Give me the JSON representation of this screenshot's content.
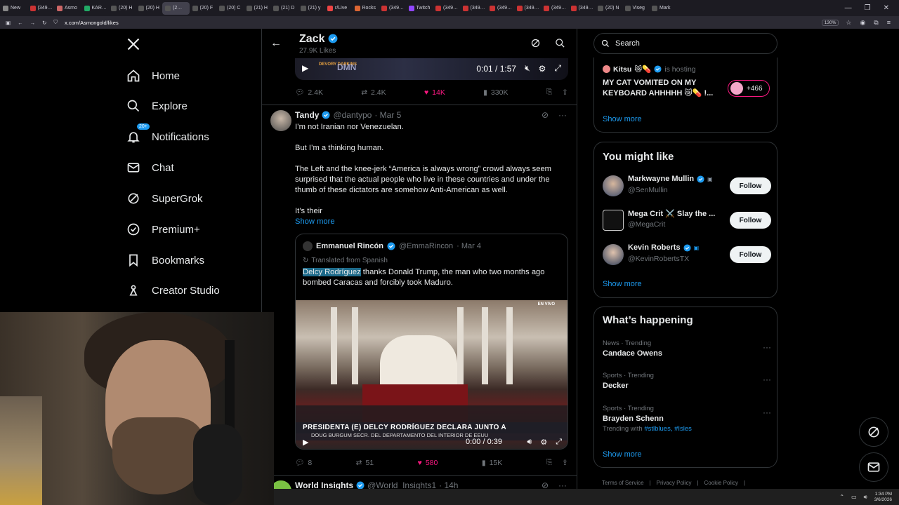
{
  "browser": {
    "tabs": [
      "New",
      "(349…",
      "Asmo",
      "KAR…",
      "(20) H",
      "(20) H",
      "(2…",
      "(20) F",
      "(20) C",
      "(21) H",
      "(21) D",
      "(21) y",
      "r/Live",
      "Rocks",
      "(349…",
      "Twitch",
      "(349…",
      "(349…",
      "(349…",
      "(349…",
      "(349…",
      "(349…",
      "(20) N",
      "Viseg",
      "Mark"
    ],
    "url": "x.com/Asmongold/likes",
    "zoom": "130%"
  },
  "nav": {
    "items": [
      {
        "label": "Home"
      },
      {
        "label": "Explore"
      },
      {
        "label": "Notifications",
        "badge": "20+"
      },
      {
        "label": "Chat"
      },
      {
        "label": "SuperGrok"
      },
      {
        "label": "Premium+"
      },
      {
        "label": "Bookmarks"
      },
      {
        "label": "Creator Studio"
      }
    ]
  },
  "header": {
    "title": "Zack",
    "subtitle": "27.9K Likes"
  },
  "prev_video": {
    "overlay": "DMN",
    "tag": "DEVORY DARKINS",
    "time": "0:01 / 1:57"
  },
  "prev_actions": {
    "replies": "2.4K",
    "reposts": "2.4K",
    "likes": "14K",
    "views": "330K"
  },
  "tweet": {
    "name": "Tandy",
    "handle": "@dantypo",
    "date": "· Mar 5",
    "lines": [
      "I’m not Iranian nor Venezuelan.",
      "But I’m a thinking human.",
      "The Left and the knee-jerk “America is always wrong” crowd always seem surprised that the actual people who live in these countries and under the thumb of these dictators are somehow Anti-American as well.",
      "It’s their"
    ],
    "show_more": "Show more",
    "quote": {
      "name": "Emmanuel Rincón",
      "handle": "@EmmaRincon",
      "date": "· Mar 4",
      "translated": "Translated from Spanish",
      "highlight": "Delcy Rodríguez",
      "text": " thanks Donald Trump, the man who two months ago bombed Caracas and forcibly took Maduro.",
      "banner_line1": "PRESIDENTA (E) DELCY RODRÍGUEZ DECLARA JUNTO A",
      "banner_line2": "DOUG BURGUM SECR. DEL DEPARTAMENTO DEL INTERIOR DE EEUU",
      "live_tag": "EN VIVO",
      "video_time": "0:00 / 0:39"
    },
    "actions": {
      "replies": "8",
      "reposts": "51",
      "likes": "580",
      "views": "15K"
    }
  },
  "next_tweet": {
    "name": "World Insights",
    "handle": "@World_Insights1",
    "date": "· 14h"
  },
  "right": {
    "search_placeholder": "Search",
    "live": {
      "host": "Kitsu",
      "hosting": "is hosting",
      "title": "MY CAT VOMITED ON MY KEYBOARD AHHHHH 😿💊 !...",
      "count": "+466",
      "show_more": "Show more"
    },
    "wtf": {
      "title": "You might like",
      "accounts": [
        {
          "name": "Markwayne Mullin",
          "handle": "@SenMullin",
          "button": "Follow"
        },
        {
          "name": "Mega Crit ⚔️ Slay the ...",
          "handle": "@MegaCrit",
          "button": "Follow"
        },
        {
          "name": "Kevin Roberts",
          "handle": "@KevinRobertsTX",
          "button": "Follow"
        }
      ],
      "show_more": "Show more"
    },
    "trends": {
      "title": "What’s happening",
      "items": [
        {
          "category": "News · Trending",
          "topic": "Candace Owens"
        },
        {
          "category": "Sports · Trending",
          "topic": "Decker"
        },
        {
          "category": "Sports · Trending",
          "topic": "Brayden Schenn",
          "with_label": "Trending with",
          "tags": "#stlblues, #Isles"
        }
      ],
      "show_more": "Show more"
    },
    "footer": [
      "Terms of Service",
      "|",
      "Privacy Policy",
      "|",
      "Cookie Policy",
      "|"
    ]
  },
  "taskbar": {
    "time": "1:34 PM",
    "date": "3/6/2026"
  },
  "colors": {
    "accent": "#1d9bf0",
    "like": "#f91880",
    "bg": "#000000",
    "border": "#2f3336"
  }
}
